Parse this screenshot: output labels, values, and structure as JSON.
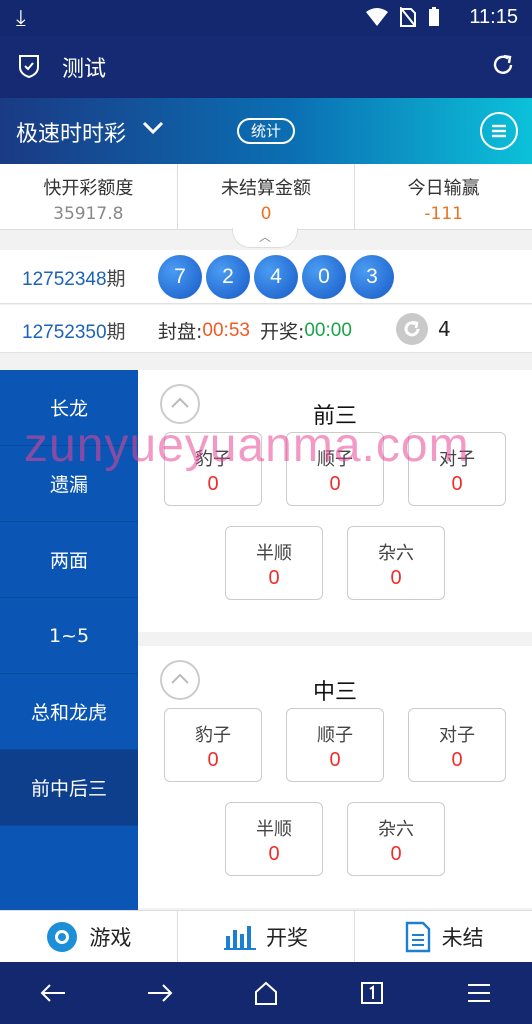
{
  "status_bar": {
    "time": "11:15"
  },
  "title_bar": {
    "title": "测试"
  },
  "game_bar": {
    "name": "极速时时彩",
    "stat_button": "统计"
  },
  "summary": [
    {
      "label": "快开彩额度",
      "value": "35917.8",
      "color": "#888888"
    },
    {
      "label": "未结算金额",
      "value": "0",
      "color": "#f0701e"
    },
    {
      "label": "今日输赢",
      "value": "-111",
      "color": "#f0701e"
    }
  ],
  "last_draw": {
    "issue": "12752348",
    "suffix": "期",
    "balls": [
      "7",
      "2",
      "4",
      "0",
      "3"
    ]
  },
  "current_draw": {
    "issue": "12752350",
    "suffix": "期",
    "close_label": "封盘:",
    "close_time": "00:53",
    "open_label": "开奖:",
    "open_time": "00:00",
    "count": "4"
  },
  "sidebar": {
    "items": [
      {
        "label": "长龙"
      },
      {
        "label": "遗漏"
      },
      {
        "label": "两面"
      },
      {
        "label": "1~5"
      },
      {
        "label": "总和龙虎"
      },
      {
        "label": "前中后三"
      }
    ],
    "active_index": 5
  },
  "panels": [
    {
      "title": "前三",
      "options": [
        {
          "name": "豹子",
          "value": "0"
        },
        {
          "name": "顺子",
          "value": "0"
        },
        {
          "name": "对子",
          "value": "0"
        },
        {
          "name": "半顺",
          "value": "0"
        },
        {
          "name": "杂六",
          "value": "0"
        }
      ]
    },
    {
      "title": "中三",
      "options": [
        {
          "name": "豹子",
          "value": "0"
        },
        {
          "name": "顺子",
          "value": "0"
        },
        {
          "name": "对子",
          "value": "0"
        },
        {
          "name": "半顺",
          "value": "0"
        },
        {
          "name": "杂六",
          "value": "0"
        }
      ]
    }
  ],
  "watermark": "zunyueyuanma.com",
  "bottom_tabs": [
    {
      "label": "游戏",
      "icon": "game-icon"
    },
    {
      "label": "开奖",
      "icon": "bar-chart-icon"
    },
    {
      "label": "未结",
      "icon": "document-icon"
    }
  ],
  "colors": {
    "accent_blue": "#0b56b5",
    "ball_blue": "#1659c7",
    "odds_red": "#f02d2d"
  }
}
